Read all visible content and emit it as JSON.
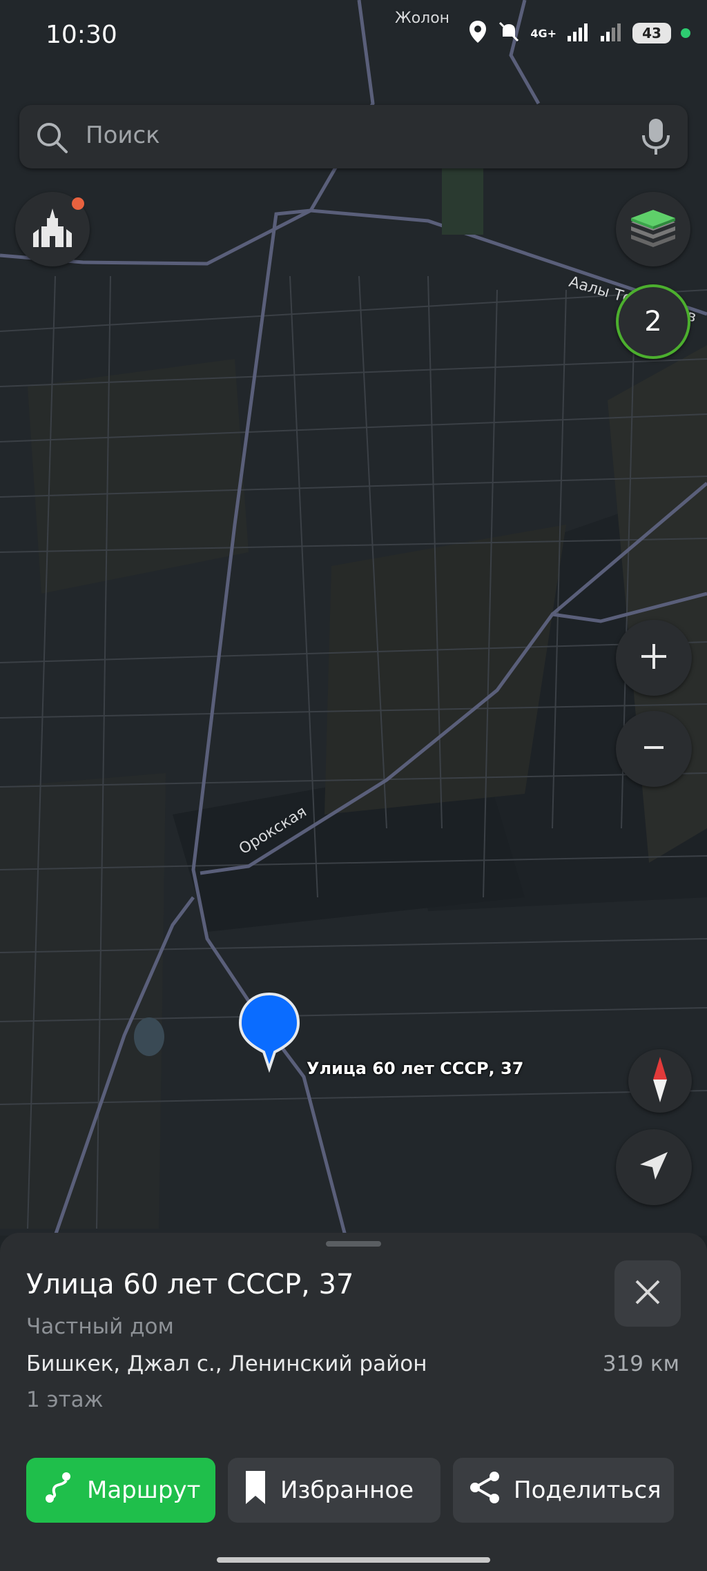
{
  "status_bar": {
    "time": "10:30",
    "battery": "43",
    "network": "4G+"
  },
  "search": {
    "placeholder": "Поиск"
  },
  "map": {
    "labels": {
      "top": "Жолон",
      "road_ne": "Аалы Токомбаев",
      "road_center": "Орокская"
    },
    "pin_label": "Улица 60 лет СССР, 37",
    "counter_badge": "2",
    "icons": {
      "landmarks": "landmarks-icon",
      "layers": "layers-icon",
      "zoom_in": "plus-icon",
      "zoom_out": "minus-icon",
      "compass": "compass-icon",
      "locate": "navigation-arrow-icon"
    }
  },
  "place": {
    "title": "Улица 60 лет СССР, 37",
    "type": "Частный дом",
    "address": "Бишкек, Джал с., Ленинский район",
    "distance": "319 км",
    "floor": "1 этаж"
  },
  "actions": {
    "route": "Маршрут",
    "favorite": "Избранное",
    "share": "Поделиться"
  },
  "colors": {
    "accent": "#1fbf4b",
    "pin": "#0a6cff",
    "counter_ring": "#4caf2e"
  }
}
